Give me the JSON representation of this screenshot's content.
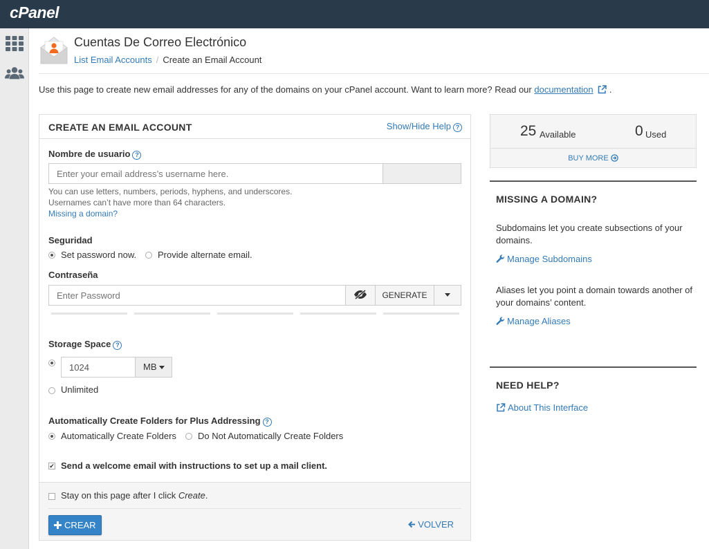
{
  "app": {
    "logo": "cPanel"
  },
  "header": {
    "title": "Cuentas De Correo Electrónico",
    "breadcrumb": {
      "parent": "List Email Accounts",
      "separator": "/",
      "current": "Create an Email Account"
    }
  },
  "intro": {
    "text": "Use this page to create new email addresses for any of the domains on your cPanel account. Want to learn more? Read our ",
    "link": "documentation",
    "suffix": "."
  },
  "form": {
    "title": "CREATE AN EMAIL ACCOUNT",
    "help_link": "Show/Hide Help",
    "username": {
      "label": "Nombre de usuario",
      "placeholder": "Enter your email address’s username here.",
      "hint_1": "You can use letters, numbers, periods, hyphens, and underscores.",
      "hint_2": "Usernames can’t have more than 64 characters.",
      "missing_domain": "Missing a domain?"
    },
    "security": {
      "label": "Seguridad",
      "option_set_password": "Set password now.",
      "option_alt_email": "Provide alternate email."
    },
    "password": {
      "label": "Contraseña",
      "placeholder": "Enter Password",
      "generate": "GENERATE"
    },
    "storage": {
      "label": "Storage Space",
      "value": "1024",
      "unit": "MB",
      "unlimited": "Unlimited"
    },
    "plus_addressing": {
      "label": "Automatically Create Folders for Plus Addressing",
      "option_auto": "Automatically Create Folders",
      "option_no_auto": "Do Not Automatically Create Folders"
    },
    "welcome_email": "Send a welcome email with instructions to set up a mail client.",
    "stay_on_page": {
      "prefix": "Stay on this page after I click ",
      "emph": "Create",
      "suffix": "."
    },
    "create_button": "CREAR",
    "back_button": "VOLVER"
  },
  "stats": {
    "available_count": "25",
    "available_label": "Available",
    "used_count": "0",
    "used_label": "Used",
    "buy_more": "BUY MORE"
  },
  "side": {
    "missing_domain": {
      "title": "MISSING A DOMAIN?",
      "subdomains_text": "Subdomains let you create subsections of your domains.",
      "subdomains_link": "Manage Subdomains",
      "aliases_text": "Aliases let you point a domain towards another of your domains’ content.",
      "aliases_link": "Manage Aliases"
    },
    "need_help": {
      "title": "NEED HELP?",
      "link": "About This Interface"
    }
  },
  "colors": {
    "topbar": "#293a4a",
    "link": "#337ab7",
    "primary_button": "#3584c8",
    "mail_icon_accent": "#f26b21"
  }
}
